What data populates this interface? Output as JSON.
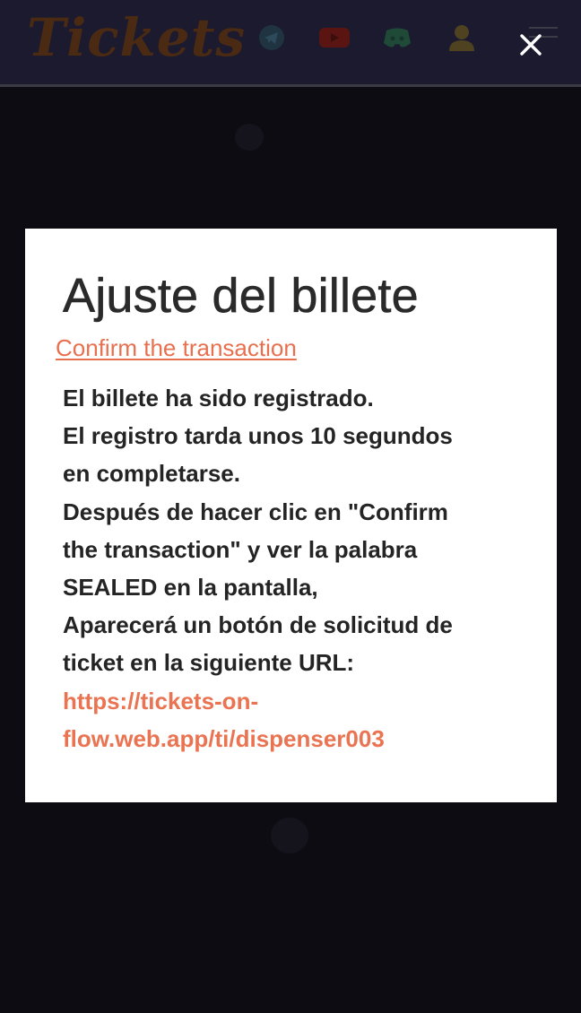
{
  "header": {
    "logo": "Tickets",
    "icons": [
      "telegram-icon",
      "youtube-icon",
      "discord-icon",
      "user-icon"
    ],
    "menu_icon": "hamburger-menu-icon"
  },
  "overlay": {
    "close_icon": "close-icon",
    "close_symbol": "✕"
  },
  "modal": {
    "title": "Ajuste del billete",
    "confirm_link": "Confirm the transaction",
    "message_lines": [
      "El billete ha sido registrado.",
      "El registro tarda unos 10 segundos",
      "en completarse.",
      "Después de hacer clic en \"Confirm",
      "the transaction\" y ver la palabra",
      "SEALED en la pantalla,",
      "Aparecerá un botón de solicitud de",
      "ticket en la siguiente URL:"
    ],
    "url_lines": [
      "https://tickets-on-",
      "flow.web.app/ti/dispenser003"
    ]
  },
  "colors": {
    "accent": "#e8704f",
    "header_bg": "#1c1a2e",
    "backdrop": "#0d0c13"
  }
}
